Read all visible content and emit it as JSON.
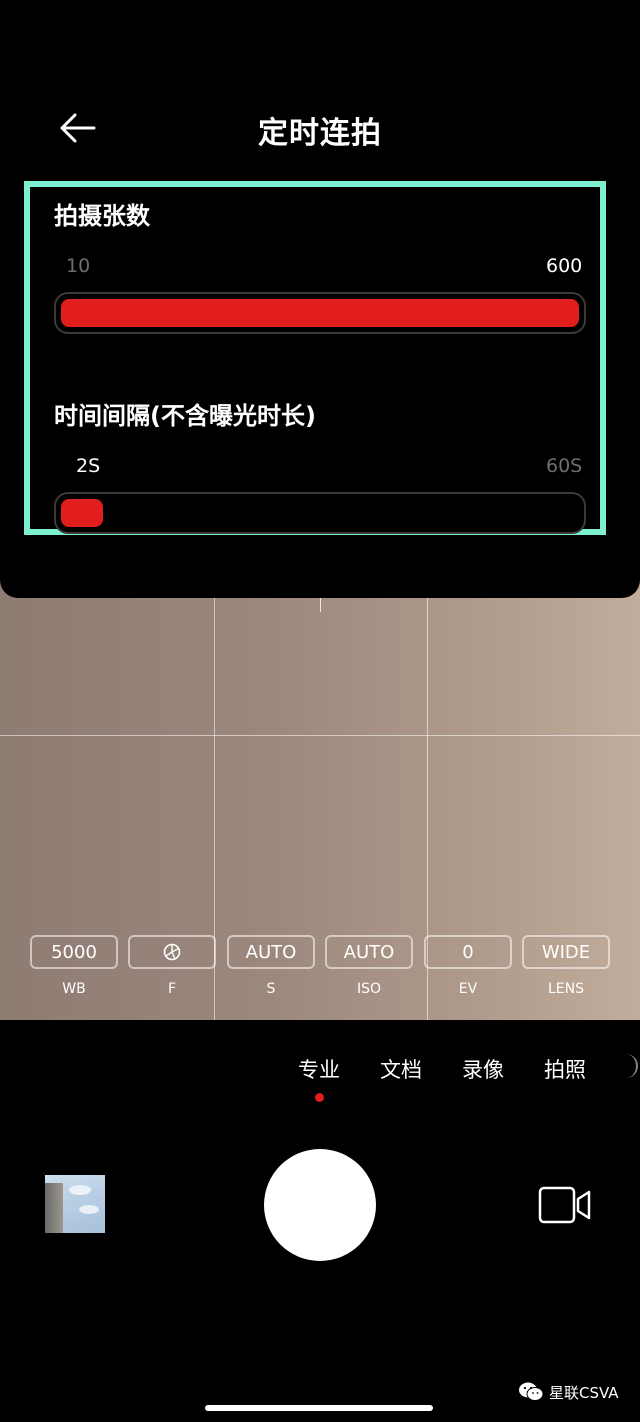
{
  "header": {
    "title": "定时连拍",
    "back_icon": "arrow-left-icon"
  },
  "settings": [
    {
      "label": "拍摄张数",
      "min": "10",
      "max": "600",
      "value_fraction": 1.0,
      "highlighted_end": "max"
    },
    {
      "label": "时间间隔(不含曝光时长)",
      "min": "2S",
      "max": "60S",
      "value_fraction": 0.0,
      "highlighted_end": "min"
    }
  ],
  "pro_params": [
    {
      "value": "5000",
      "label": "WB"
    },
    {
      "value": "",
      "icon": "aperture-icon",
      "label": "F"
    },
    {
      "value": "AUTO",
      "label": "S"
    },
    {
      "value": "AUTO",
      "label": "ISO"
    },
    {
      "value": "0",
      "label": "EV"
    },
    {
      "value": "WIDE",
      "label": "LENS"
    }
  ],
  "modes": {
    "items": [
      "专业",
      "文档",
      "录像",
      "拍照"
    ],
    "active": "专业"
  },
  "watermark": {
    "text": "星联CSVA",
    "icon": "wechat-icon"
  },
  "colors": {
    "accent": "#e11d1d",
    "highlight_border": "#7ff0cf",
    "background": "#000000"
  }
}
